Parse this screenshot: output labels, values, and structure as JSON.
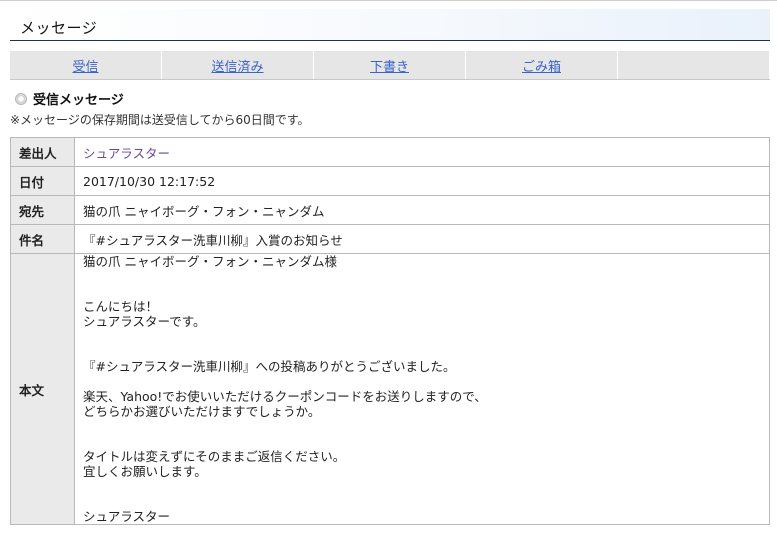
{
  "page": {
    "title": "メッセージ"
  },
  "tabs": [
    {
      "label": "受信"
    },
    {
      "label": "送信済み"
    },
    {
      "label": "下書き"
    },
    {
      "label": "ごみ箱"
    }
  ],
  "section": {
    "title": "受信メッセージ",
    "note": "※メッセージの保存期間は送受信してから60日間です。"
  },
  "message": {
    "sender_label": "差出人",
    "sender": "シュアラスター",
    "date_label": "日付",
    "date": "2017/10/30 12:17:52",
    "to_label": "宛先",
    "to": "猫の爪 ニャイボーグ・フォン・ニャンダム",
    "subject_label": "件名",
    "subject": "『#シュアラスター洗車川柳』入賞のお知らせ",
    "body_label": "本文",
    "body_lines": [
      "猫の爪 ニャイボーグ・フォン・ニャンダム様",
      "",
      "",
      "こんにちは！",
      "シュアラスターです。",
      "",
      "",
      "『#シュアラスター洗車川柳』への投稿ありがとうございました。",
      "",
      "楽天、Yahoo!でお使いいただけるクーポンコードをお送りしますので、",
      "どちらかお選びいただけますでしょうか。",
      "",
      "",
      "タイトルは変えずにそのままご返信ください。",
      "宜しくお願いします。",
      "",
      "",
      "シュアラスター"
    ]
  }
}
